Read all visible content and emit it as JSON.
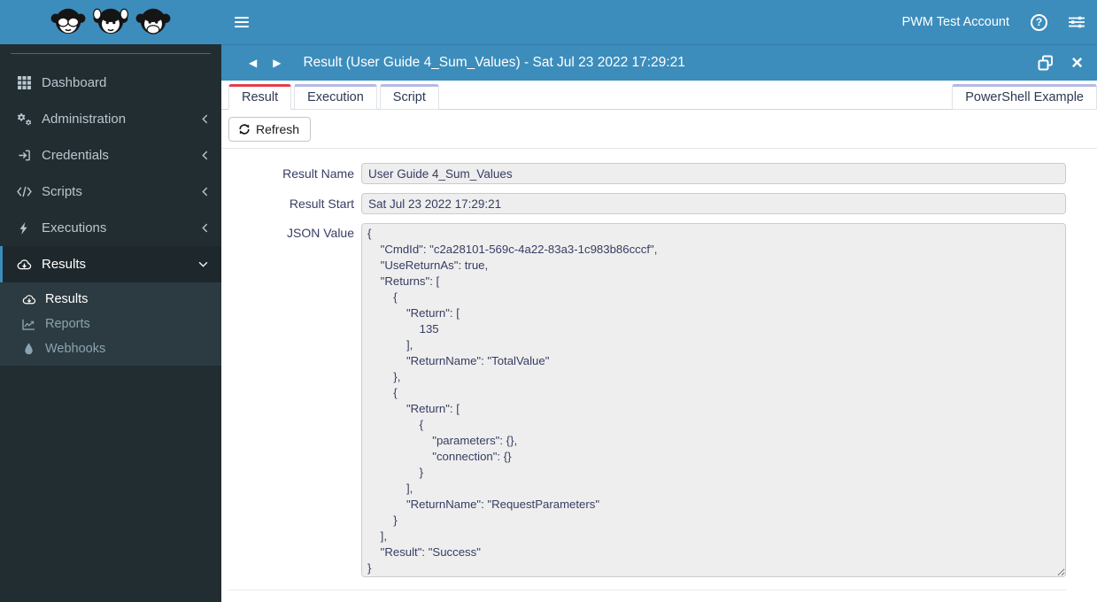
{
  "colors": {
    "brand_blue": "#3c8dbc",
    "sidebar_bg": "#222d32",
    "submenu_bg": "#2c3b41",
    "active_item_bg": "#1e282c",
    "active_tab_accent": "#e23f4e",
    "inactive_tab_accent": "#b6b9e2",
    "field_bg": "#eeeeee"
  },
  "sidebar": {
    "logo": "three-monkeys-logo",
    "items": [
      {
        "label": "Dashboard",
        "icon": "grid-icon"
      },
      {
        "label": "Administration",
        "icon": "gears-icon",
        "chevron": "left"
      },
      {
        "label": "Credentials",
        "icon": "sign-in-icon",
        "chevron": "left"
      },
      {
        "label": "Scripts",
        "icon": "code-icon",
        "chevron": "left"
      },
      {
        "label": "Executions",
        "icon": "bolt-icon",
        "chevron": "left"
      },
      {
        "label": "Results",
        "icon": "cloud-download-icon",
        "chevron": "down",
        "active": true
      }
    ],
    "subitems": [
      {
        "label": "Results",
        "icon": "cloud-download-icon",
        "active": true
      },
      {
        "label": "Reports",
        "icon": "chart-line-icon"
      },
      {
        "label": "Webhooks",
        "icon": "droplet-icon"
      }
    ]
  },
  "topbar": {
    "account_name": "PWM Test Account"
  },
  "window": {
    "title": "Result (User Guide 4_Sum_Values) - Sat Jul 23 2022 17:29:21"
  },
  "tabs": {
    "items": [
      {
        "label": "Result",
        "active": true
      },
      {
        "label": "Execution"
      },
      {
        "label": "Script"
      }
    ],
    "right_label": "PowerShell Example"
  },
  "toolbar": {
    "refresh_label": "Refresh"
  },
  "form": {
    "result_name": {
      "label": "Result Name",
      "value": "User Guide 4_Sum_Values"
    },
    "result_start": {
      "label": "Result Start",
      "value": "Sat Jul 23 2022 17:29:21"
    },
    "json": {
      "label": "JSON Value",
      "value": "{\n    \"CmdId\": \"c2a28101-569c-4a22-83a3-1c983b86cccf\",\n    \"UseReturnAs\": true,\n    \"Returns\": [\n        {\n            \"Return\": [\n                135\n            ],\n            \"ReturnName\": \"TotalValue\"\n        },\n        {\n            \"Return\": [\n                {\n                    \"parameters\": {},\n                    \"connection\": {}\n                }\n            ],\n            \"ReturnName\": \"RequestParameters\"\n        }\n    ],\n    \"Result\": \"Success\"\n}"
    }
  }
}
